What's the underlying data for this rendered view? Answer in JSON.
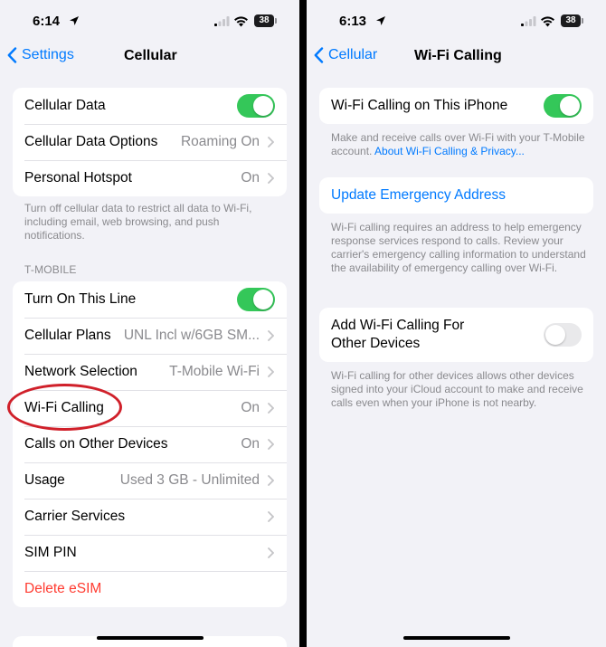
{
  "left": {
    "status": {
      "time": "6:14",
      "battery": "38"
    },
    "nav": {
      "back_label": "Settings",
      "title": "Cellular"
    },
    "group1": [
      {
        "label": "Cellular Data",
        "toggle": true
      },
      {
        "label": "Cellular Data Options",
        "value": "Roaming On"
      },
      {
        "label": "Personal Hotspot",
        "value": "On"
      }
    ],
    "group1_footer": "Turn off cellular data to restrict all data to Wi-Fi, including email, web browsing, and push notifications.",
    "section_header": "T-MOBILE",
    "group2": [
      {
        "label": "Turn On This Line",
        "toggle": true
      },
      {
        "label": "Cellular Plans",
        "value": "UNL Incl w/6GB SM..."
      },
      {
        "label": "Network Selection",
        "value": "T-Mobile Wi-Fi"
      },
      {
        "label": "Wi-Fi Calling",
        "value": "On"
      },
      {
        "label": "Calls on Other Devices",
        "value": "On"
      },
      {
        "label": "Usage",
        "value": "Used 3 GB - Unlimited"
      },
      {
        "label": "Carrier Services",
        "value": ""
      },
      {
        "label": "SIM PIN",
        "value": ""
      },
      {
        "label": "Delete eSIM"
      }
    ]
  },
  "right": {
    "status": {
      "time": "6:13",
      "battery": "38"
    },
    "nav": {
      "back_label": "Cellular",
      "title": "Wi-Fi Calling"
    },
    "wifi_calling_row": {
      "label": "Wi-Fi Calling on This iPhone",
      "toggle": true
    },
    "wifi_calling_footer": "Make and receive calls over Wi-Fi with your T-Mobile account.",
    "wifi_calling_footer_link": "About Wi-Fi Calling & Privacy...",
    "emergency_row": {
      "label": "Update Emergency Address"
    },
    "emergency_footer": "Wi-Fi calling requires an address to help emergency response services respond to calls. Review your carrier's emergency calling information to understand the availability of emergency calling over Wi-Fi.",
    "other_devices_row": {
      "label_line1": "Add Wi-Fi Calling For",
      "label_line2": "Other Devices",
      "toggle": false
    },
    "other_devices_footer": "Wi-Fi calling for other devices allows other devices signed into your iCloud account to make and receive calls even when your iPhone is not nearby."
  },
  "colors": {
    "accent": "#007aff",
    "toggle_on": "#34c759",
    "destructive": "#ff3b30",
    "highlight_circle": "#d0202a"
  }
}
